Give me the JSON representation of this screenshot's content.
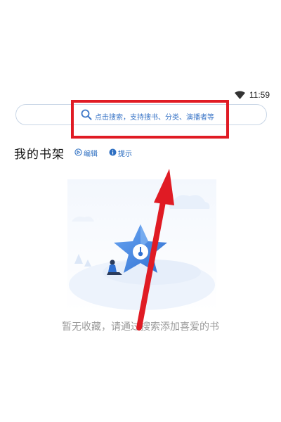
{
  "status_bar": {
    "time": "11:59",
    "wifi_icon": "wifi-icon"
  },
  "search": {
    "placeholder": "点击搜索，支持搜书、分类、演播者等",
    "icon": "search-icon"
  },
  "shelf": {
    "title": "我的书架",
    "actions": [
      {
        "label": "编辑",
        "icon": "edit-icon"
      },
      {
        "label": "提示",
        "icon": "info-icon"
      }
    ]
  },
  "empty_state": {
    "message": "暂无收藏，请通过搜索添加喜爱的书",
    "illustration": "star-with-person-illustration"
  },
  "annotations": {
    "highlight_color": "#e01b24",
    "arrow_color": "#e01b24"
  },
  "colors": {
    "accent": "#3b76c7",
    "muted_text": "#9a9a9a"
  }
}
